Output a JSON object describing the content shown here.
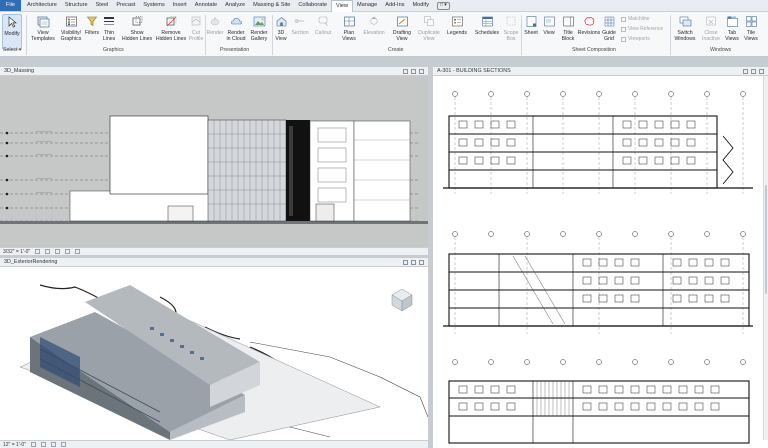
{
  "ribbon": {
    "tabs": [
      {
        "label": "File",
        "kind": "file"
      },
      {
        "label": "Architecture"
      },
      {
        "label": "Structure"
      },
      {
        "label": "Steel"
      },
      {
        "label": "Precast"
      },
      {
        "label": "Systems"
      },
      {
        "label": "Insert"
      },
      {
        "label": "Annotate"
      },
      {
        "label": "Analyze"
      },
      {
        "label": "Massing & Site"
      },
      {
        "label": "Collaborate"
      },
      {
        "label": "View",
        "kind": "active"
      },
      {
        "label": "Manage"
      },
      {
        "label": "Add-Ins"
      },
      {
        "label": "Modify"
      }
    ],
    "extra_tab_badge": "□ ▾",
    "tools": {
      "modify": "Modify",
      "view_templates": "View\nTemplates",
      "visibility_graphics": "Visibility/\nGraphics",
      "filters": "Filters",
      "thin_lines": "Thin\nLines",
      "show_hidden_lines": "Show\nHidden Lines",
      "remove_hidden_lines": "Remove\nHidden Lines",
      "cut_profile": "Cut\nProfile",
      "render": "Render",
      "render_in_cloud": "Render\nin Cloud",
      "render_gallery": "Render\nGallery",
      "view_3d": "3D\nView",
      "section": "Section",
      "callout": "Callout",
      "plan_views": "Plan\nViews",
      "elevation": "Elevation",
      "drafting_view": "Drafting\nView",
      "duplicate_view": "Duplicate\nView",
      "legends": "Legends",
      "schedules": "Schedules",
      "scope_box": "Scope\nBox",
      "sheet": "Sheet",
      "view": "View",
      "title_block": "Title\nBlock",
      "revisions": "Revisions",
      "guide_grid": "Guide\nGrid",
      "matchline": "Matchline",
      "view_reference": "View Reference",
      "viewports": "Viewports",
      "switch_windows": "Switch\nWindows",
      "close_inactive": "Close\nInactive",
      "tab_views": "Tab\nViews",
      "tile_views": "Tile\nViews"
    },
    "panels": {
      "select": "Select ▾",
      "graphics": "Graphics",
      "presentation": "Presentation",
      "create": "Create",
      "sheet_composition": "Sheet Composition",
      "windows": "Windows"
    }
  },
  "views": {
    "massing": {
      "title": "3D_Massing",
      "scale": "3/32\" = 1'-0\""
    },
    "rendering": {
      "title": "3D_ExteriorRendering",
      "scale": "12\" = 1'-0\""
    },
    "sections": {
      "title": "A-301 - BUILDING SECTIONS"
    }
  },
  "colors": {
    "accent": "#2f6db5",
    "ribbon_bg": "#f7f8fa",
    "tabbar_bg": "#e9edf2",
    "workspace_bg": "#c7ccd1"
  }
}
